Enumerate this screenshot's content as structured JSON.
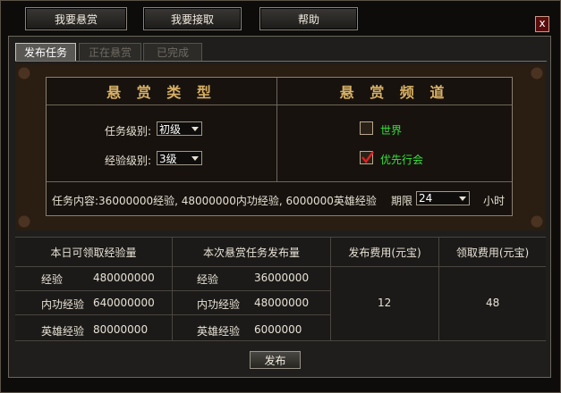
{
  "top_buttons": {
    "post_bounty": "我要悬赏",
    "accept_bounty": "我要接取",
    "help": "帮助",
    "close": "x"
  },
  "tabs": [
    {
      "label": "发布任务",
      "active": true
    },
    {
      "label": "正在悬赏",
      "active": false
    },
    {
      "label": "已完成",
      "active": false
    }
  ],
  "bounty_type": {
    "title": "悬 赏 类 型",
    "task_level_label": "任务级别:",
    "task_level_value": "初级",
    "exp_level_label": "经验级别:",
    "exp_level_value": "3级"
  },
  "bounty_channel": {
    "title": "悬 赏 频 道",
    "world_label": "世界",
    "world_checked": false,
    "guild_label": "优先行会",
    "guild_checked": true
  },
  "task_content": "任务内容:36000000经验, 48000000内功经验, 6000000英雄经验",
  "deadline": {
    "label": "期限",
    "value": "24",
    "unit": "小时"
  },
  "table": {
    "headers": [
      "本日可领取经验量",
      "本次悬赏任务发布量",
      "发布费用(元宝)",
      "领取费用(元宝)"
    ],
    "daily_rows": [
      {
        "label": "经验",
        "value": "480000000"
      },
      {
        "label": "内功经验",
        "value": "640000000"
      },
      {
        "label": "英雄经验",
        "value": "80000000"
      }
    ],
    "publish_rows": [
      {
        "label": "经验",
        "value": "36000000"
      },
      {
        "label": "内功经验",
        "value": "48000000"
      },
      {
        "label": "英雄经验",
        "value": "6000000"
      }
    ],
    "publish_fee": "12",
    "claim_fee": "48"
  },
  "publish_button": "发布",
  "colors": {
    "gold_title": "#d8b064",
    "green_text": "#36e23c",
    "check_red": "#e02020"
  }
}
